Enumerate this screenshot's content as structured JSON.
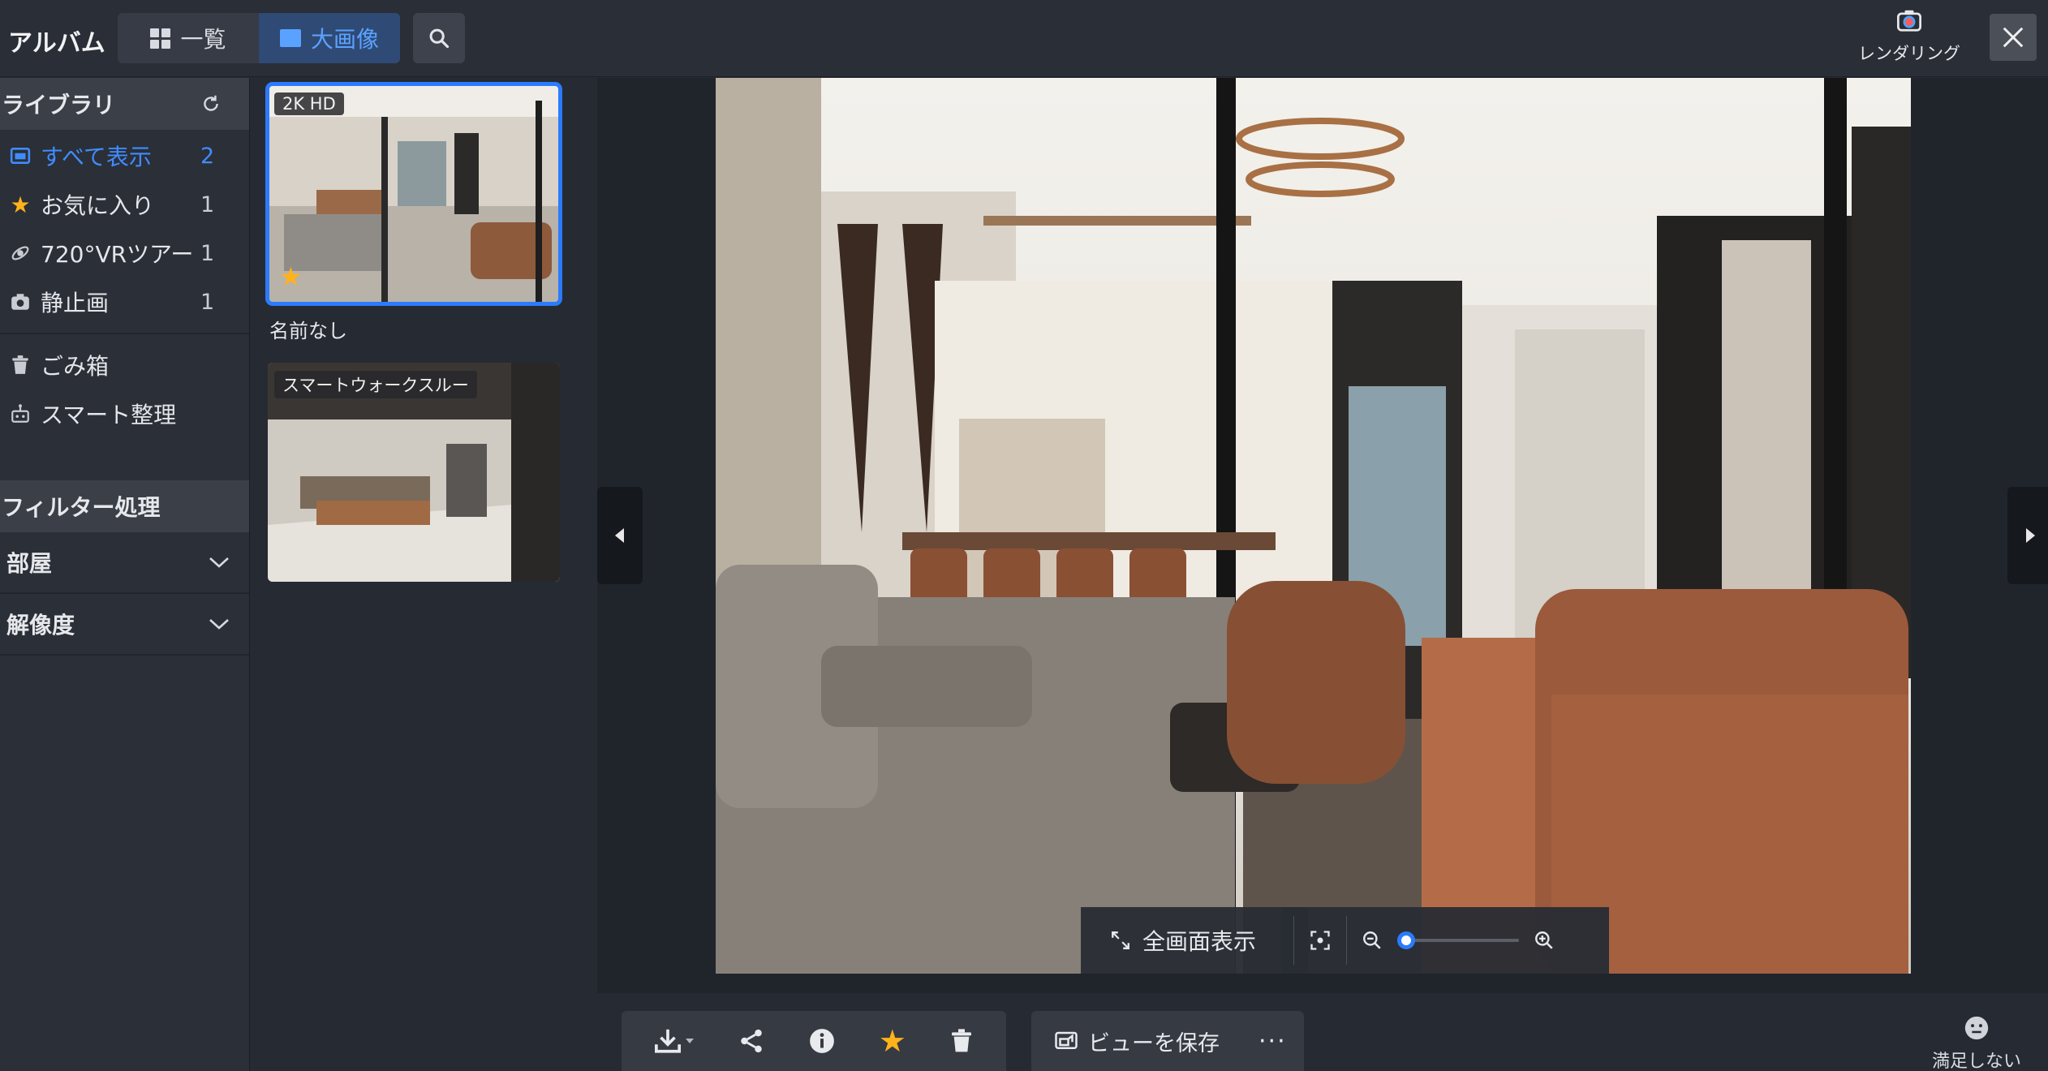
{
  "header": {
    "app_title": "アルバム",
    "view_list_label": "一覧",
    "view_large_label": "大画像",
    "render_label": "レンダリング"
  },
  "sidebar": {
    "library_title": "ライブラリ",
    "items": [
      {
        "label": "すべて表示",
        "count": "2"
      },
      {
        "label": "お気に入り",
        "count": "1"
      },
      {
        "label": "720°VRツアー",
        "count": "1"
      },
      {
        "label": "静止画",
        "count": "1"
      }
    ],
    "trash_label": "ごみ箱",
    "smart_label": "スマート整理",
    "filter_title": "フィルター処理",
    "filters": [
      {
        "label": "部屋"
      },
      {
        "label": "解像度"
      }
    ]
  },
  "thumbnails": [
    {
      "badge": "2K HD",
      "name": "名前なし"
    },
    {
      "badge": "スマートウォークスルー"
    }
  ],
  "viewer": {
    "fullscreen_label": "全画面表示",
    "zoom_level": 0.0
  },
  "actions": {
    "save_view_label": "ビューを保存",
    "more_label": "···"
  },
  "feedback": {
    "label": "満足しない"
  }
}
